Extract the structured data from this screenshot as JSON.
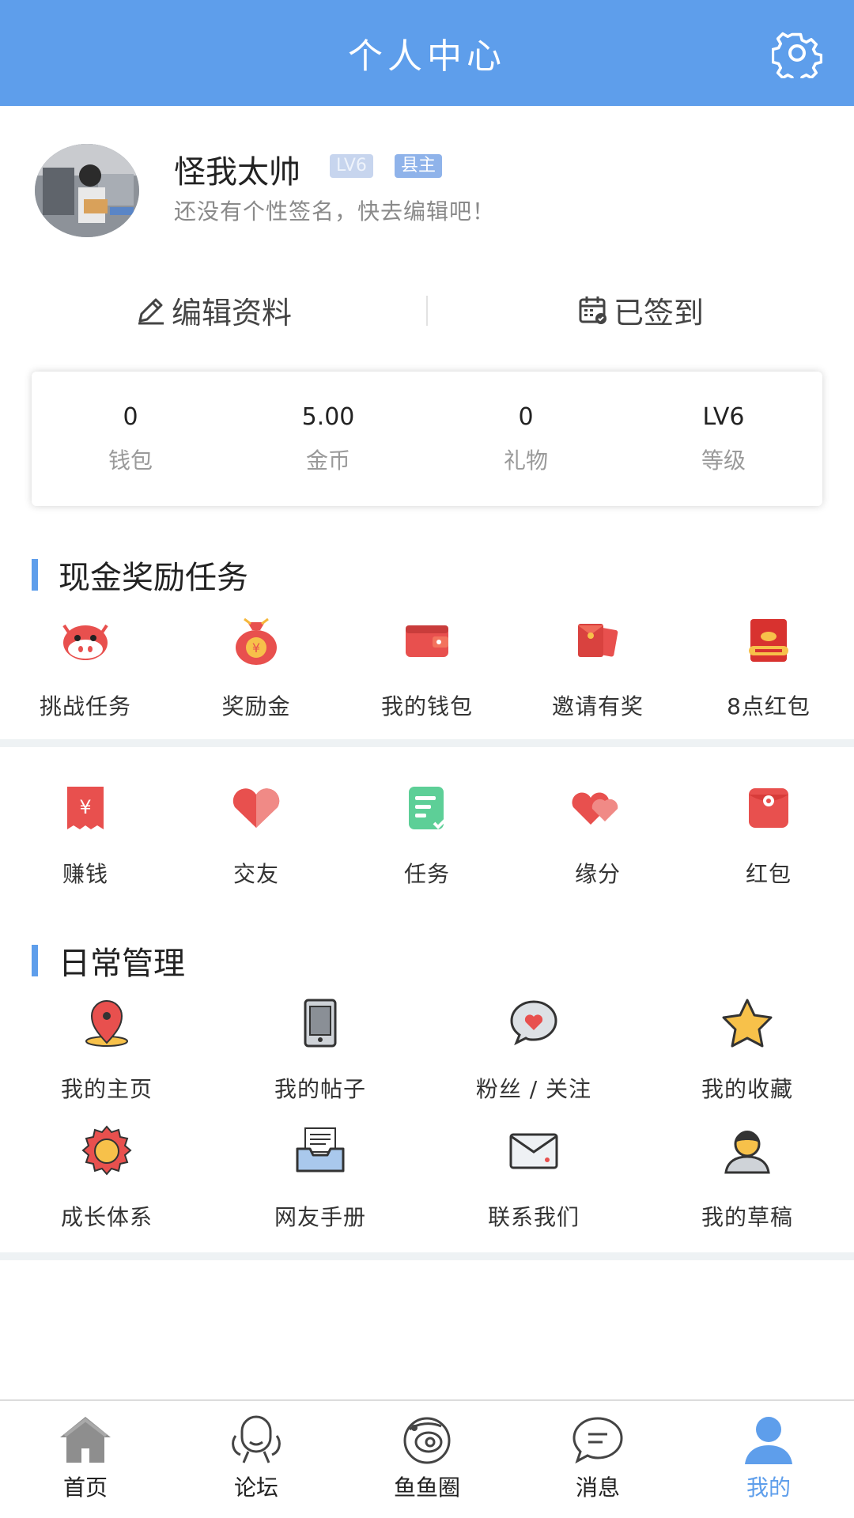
{
  "header": {
    "title": "个人中心",
    "settings_icon": "gear-icon"
  },
  "profile": {
    "name": "怪我太帅",
    "level_badge": "LV6",
    "rank_badge": "县主",
    "signature": "还没有个性签名，快去编辑吧！"
  },
  "actions": {
    "edit_label": "编辑资料",
    "checkin_label": "已签到"
  },
  "stats": [
    {
      "value": "0",
      "label": "钱包"
    },
    {
      "value": "5.00",
      "label": "金币"
    },
    {
      "value": "0",
      "label": "礼物"
    },
    {
      "value": "LV6",
      "label": "等级"
    }
  ],
  "cash_section": {
    "title": "现金奖励任务",
    "row1": [
      {
        "label": "挑战任务",
        "icon": "cow-icon"
      },
      {
        "label": "奖励金",
        "icon": "money-bag-icon"
      },
      {
        "label": "我的钱包",
        "icon": "wallet-icon"
      },
      {
        "label": "邀请有奖",
        "icon": "red-envelopes-icon"
      },
      {
        "label": "8点红包",
        "icon": "get-red-packet-icon"
      }
    ],
    "row2": [
      {
        "label": "赚钱",
        "icon": "yuan-receipt-icon"
      },
      {
        "label": "交友",
        "icon": "heart-icon"
      },
      {
        "label": "任务",
        "icon": "task-icon"
      },
      {
        "label": "缘分",
        "icon": "double-heart-icon"
      },
      {
        "label": "红包",
        "icon": "red-packet-icon"
      }
    ]
  },
  "daily_section": {
    "title": "日常管理",
    "row1": [
      {
        "label": "我的主页",
        "icon": "location-pin-icon"
      },
      {
        "label": "我的帖子",
        "icon": "tablet-icon"
      },
      {
        "label": "粉丝 / 关注",
        "icon": "heart-bubble-icon"
      },
      {
        "label": "我的收藏",
        "icon": "star-icon"
      }
    ],
    "row2": [
      {
        "label": "成长体系",
        "icon": "medal-icon"
      },
      {
        "label": "网友手册",
        "icon": "inbox-tray-icon"
      },
      {
        "label": "联系我们",
        "icon": "envelope-icon"
      },
      {
        "label": "我的草稿",
        "icon": "person-icon"
      }
    ]
  },
  "tabbar": [
    {
      "label": "首页",
      "icon": "home-icon"
    },
    {
      "label": "论坛",
      "icon": "forum-icon"
    },
    {
      "label": "鱼鱼圈",
      "icon": "planet-icon"
    },
    {
      "label": "消息",
      "icon": "message-icon"
    },
    {
      "label": "我的",
      "icon": "user-icon",
      "active": true
    }
  ],
  "colors": {
    "accent": "#5e9eeb",
    "red": "#e8504e",
    "green": "#5dcf97"
  }
}
